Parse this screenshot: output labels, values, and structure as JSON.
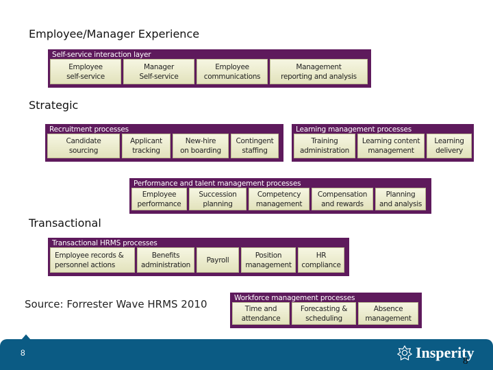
{
  "headings": {
    "experience": "Employee/Manager Experience",
    "strategic": "Strategic",
    "transactional": "Transactional"
  },
  "groups": {
    "self_service": {
      "title": "Self-service interaction layer",
      "items": [
        "Employee\nself-service",
        "Manager\nSelf-service",
        "Employee\ncommunications",
        "Management\nreporting and analysis"
      ]
    },
    "recruitment": {
      "title": "Recruitment processes",
      "items": [
        "Candidate\nsourcing",
        "Applicant\ntracking",
        "New-hire\non boarding",
        "Contingent\nstaffing"
      ]
    },
    "learning": {
      "title": "Learning management processes",
      "items": [
        "Training\nadministration",
        "Learning content\nmanagement",
        "Learning\ndelivery"
      ]
    },
    "performance": {
      "title": "Performance and talent management processes",
      "items": [
        "Employee\nperformance",
        "Succession\nplanning",
        "Competency\nmanagement",
        "Compensation\nand rewards",
        "Planning\nand analysis"
      ]
    },
    "transactional_hrms": {
      "title": "Transactional HRMS processes",
      "items": [
        "Employee records &\npersonnel actions",
        "Benefits\nadministration",
        "Payroll",
        "Position\nmanagement",
        "HR\ncompliance"
      ]
    },
    "workforce": {
      "title": "Workforce management processes",
      "items": [
        "Time and\nattendance",
        "Forecasting &\nscheduling",
        "Absence\nmanagement"
      ]
    }
  },
  "source": "Source: Forrester Wave HRMS 2010",
  "footer": {
    "page_number": "8",
    "logo_text": "Insperity",
    "logo_icon": "insperity-star-icon",
    "page_number_overlay": "8",
    "color": "#0b5b84"
  },
  "colors": {
    "group_bg": "#5e1a5c",
    "cell_bg": "#efefd4"
  }
}
